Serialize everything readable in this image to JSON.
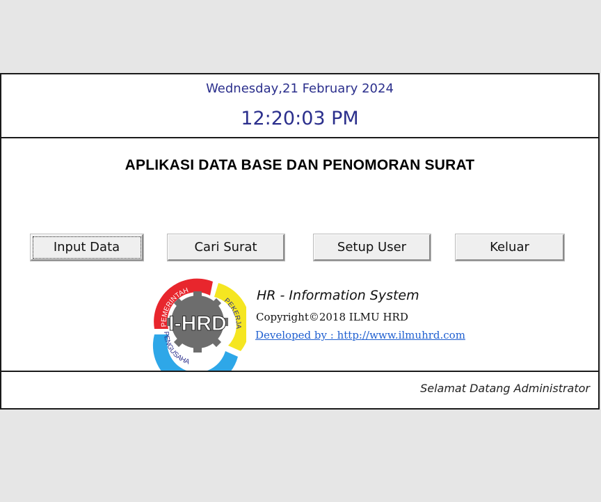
{
  "header": {
    "date": "Wednesday,21 February 2024",
    "time": "12:20:03 PM"
  },
  "app": {
    "title": "APLIKASI DATA BASE DAN PENOMORAN SURAT"
  },
  "buttons": {
    "input_data": "Input Data",
    "cari_surat": "Cari Surat",
    "setup_user": "Setup User",
    "keluar": "Keluar"
  },
  "info": {
    "system_title": "HR - Information System",
    "copyright": "Copyright©2018 ILMU HRD",
    "developed_by": "Developed by : http://www.ilmuhrd.com"
  },
  "logo": {
    "center_text": "I-HRD",
    "ring_words": [
      "PEMERINTAH",
      "PEKERJA",
      "PENGUSAHA"
    ],
    "colors": {
      "red": "#e8262d",
      "yellow": "#f5e621",
      "blue": "#2ea7e8",
      "gray": "#6d6d6d"
    }
  },
  "footer": {
    "welcome": "Selamat Datang Administrator"
  },
  "theme": {
    "header_text_color": "#2b2f8c",
    "link_color": "#1f5fd0"
  }
}
